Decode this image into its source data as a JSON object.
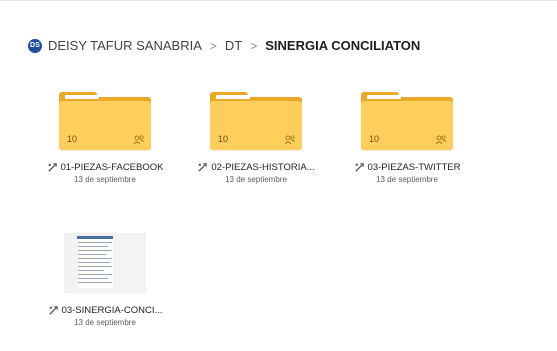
{
  "breadcrumb": {
    "avatar_initials": "DS",
    "items": [
      "DEISY TAFUR SANABRIA",
      "DT",
      "SINERGIA CONCILIATON"
    ],
    "separator": ">"
  },
  "folders": [
    {
      "name": "01-PIEZAS-FACEBOOK",
      "date": "13 de septiembre",
      "count": "10"
    },
    {
      "name": "02-PIEZAS-HISTORIA...",
      "date": "13 de septiembre",
      "count": "10"
    },
    {
      "name": "03-PIEZAS-TWITTER",
      "date": "13 de septiembre",
      "count": "10"
    }
  ],
  "files": [
    {
      "name": "03-SINERGIA-CONCI...",
      "date": "13 de septiembre"
    }
  ],
  "colors": {
    "folder_front": "#ffce5c",
    "folder_back": "#e9a825",
    "avatar": "#1f4e9a"
  }
}
